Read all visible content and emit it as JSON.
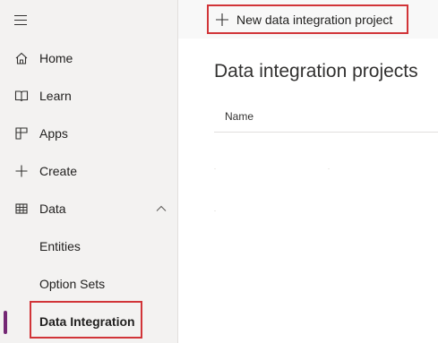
{
  "sidebar": {
    "menu_icon": "hamburger-icon",
    "items": [
      {
        "label": "Home",
        "icon": "home-icon"
      },
      {
        "label": "Learn",
        "icon": "book-icon"
      },
      {
        "label": "Apps",
        "icon": "apps-icon"
      },
      {
        "label": "Create",
        "icon": "plus-icon"
      },
      {
        "label": "Data",
        "icon": "table-icon",
        "expanded": true
      },
      {
        "label": "Entities"
      },
      {
        "label": "Option Sets"
      },
      {
        "label": "Data Integration",
        "selected": true
      }
    ]
  },
  "toolbar": {
    "new_project_label": "New data integration project",
    "new_project_icon": "plus-icon"
  },
  "main": {
    "title": "Data integration projects",
    "columns": [
      "Name"
    ]
  },
  "colors": {
    "highlight": "#d13438",
    "accent": "#742774"
  }
}
